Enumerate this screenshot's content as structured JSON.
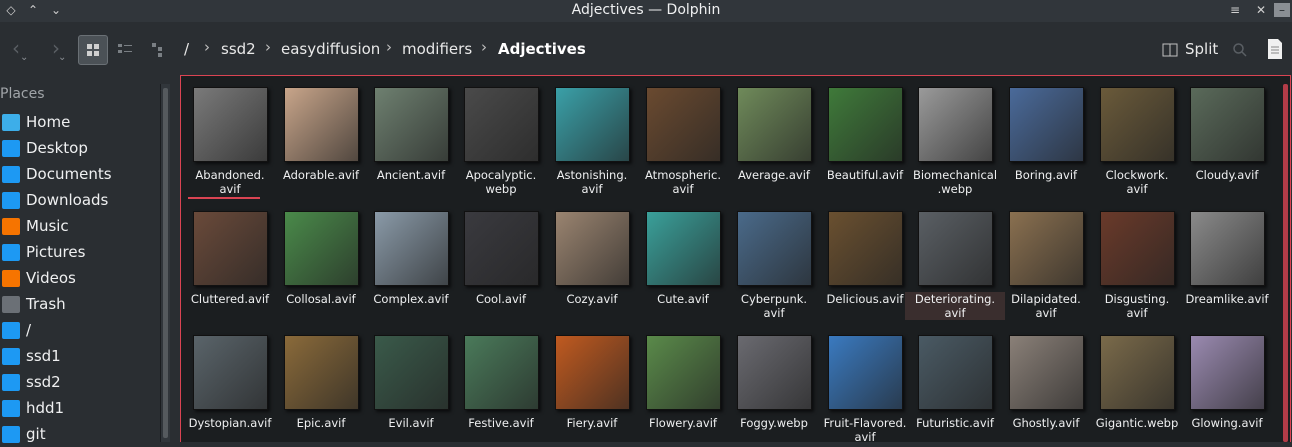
{
  "window": {
    "title": "Adjectives — Dolphin"
  },
  "titlebar": {
    "left_icons": [
      "menu-icon",
      "chevron-up-icon",
      "chevron-down-icon"
    ],
    "right_icons": [
      "hamburger-icon",
      "close-icon",
      "minimize-icon"
    ]
  },
  "toolbar": {
    "breadcrumb": [
      "/",
      "ssd2",
      "easydiffusion",
      "modifiers",
      "Adjectives"
    ],
    "split_label": "Split"
  },
  "sidebar": {
    "heading": "Places",
    "items": [
      {
        "label": "Home",
        "icon": "home-icon",
        "color": "#3daee9"
      },
      {
        "label": "Desktop",
        "icon": "desktop-icon",
        "color": "#1d99f3"
      },
      {
        "label": "Documents",
        "icon": "documents-icon",
        "color": "#1d99f3"
      },
      {
        "label": "Downloads",
        "icon": "downloads-icon",
        "color": "#1d99f3"
      },
      {
        "label": "Music",
        "icon": "music-icon",
        "color": "#f67400"
      },
      {
        "label": "Pictures",
        "icon": "pictures-icon",
        "color": "#1d99f3"
      },
      {
        "label": "Videos",
        "icon": "videos-icon",
        "color": "#f67400"
      },
      {
        "label": "Trash",
        "icon": "trash-icon",
        "color": "#6b7076"
      },
      {
        "label": "/",
        "icon": "root-icon",
        "color": "#1d99f3"
      },
      {
        "label": "ssd1",
        "icon": "drive-icon",
        "color": "#1d99f3"
      },
      {
        "label": "ssd2",
        "icon": "drive-icon",
        "color": "#1d99f3"
      },
      {
        "label": "hdd1",
        "icon": "drive-icon",
        "color": "#1d99f3"
      },
      {
        "label": "git",
        "icon": "folder-icon",
        "color": "#1d99f3"
      }
    ]
  },
  "files": [
    [
      {
        "l1": "Abandoned.",
        "l2": "avif",
        "c": "#7a7a7a"
      },
      {
        "l1": "Adorable.avif",
        "l2": "",
        "c": "#c8a58a"
      },
      {
        "l1": "Ancient.avif",
        "l2": "",
        "c": "#6e8070"
      },
      {
        "l1": "Apocalyptic.",
        "l2": "webp",
        "c": "#4a4a4a"
      },
      {
        "l1": "Astonishing.",
        "l2": "avif",
        "c": "#3aa0a8"
      },
      {
        "l1": "Atmospheric.",
        "l2": "avif",
        "c": "#6a4a30"
      },
      {
        "l1": "Average.avif",
        "l2": "",
        "c": "#6f8a5a"
      },
      {
        "l1": "Beautiful.avif",
        "l2": "",
        "c": "#3f7a3a"
      },
      {
        "l1": "Biomechanical",
        "l2": ".webp",
        "c": "#9a9a9a"
      },
      {
        "l1": "Boring.avif",
        "l2": "",
        "c": "#4a6a9a"
      },
      {
        "l1": "Clockwork.",
        "l2": "avif",
        "c": "#6a5a3a"
      },
      {
        "l1": "Cloudy.avif",
        "l2": "",
        "c": "#5a6a5a"
      }
    ],
    [
      {
        "l1": "Cluttered.avif",
        "l2": "",
        "c": "#6a4a3a"
      },
      {
        "l1": "Collosal.avif",
        "l2": "",
        "c": "#4a8a4a"
      },
      {
        "l1": "Complex.avif",
        "l2": "",
        "c": "#8a9aa8"
      },
      {
        "l1": "Cool.avif",
        "l2": "",
        "c": "#3a3a3f"
      },
      {
        "l1": "Cozy.avif",
        "l2": "",
        "c": "#9a8470"
      },
      {
        "l1": "Cute.avif",
        "l2": "",
        "c": "#3aa09a"
      },
      {
        "l1": "Cyberpunk.",
        "l2": "avif",
        "c": "#4a6a8a"
      },
      {
        "l1": "Delicious.avif",
        "l2": "",
        "c": "#6a5030"
      },
      {
        "l1": "Deteriorating.",
        "l2": "avif",
        "c": "#5a5f64"
      },
      {
        "l1": "Dilapidated.",
        "l2": "avif",
        "c": "#8a7050"
      },
      {
        "l1": "Disgusting.",
        "l2": "avif",
        "c": "#6a3a2a"
      },
      {
        "l1": "Dreamlike.avif",
        "l2": "",
        "c": "#8a8a8a"
      }
    ],
    [
      {
        "l1": "Dystopian.avif",
        "l2": "",
        "c": "#5a646a"
      },
      {
        "l1": "Epic.avif",
        "l2": "",
        "c": "#8a6a3a"
      },
      {
        "l1": "Evil.avif",
        "l2": "",
        "c": "#3a5a4a"
      },
      {
        "l1": "Festive.avif",
        "l2": "",
        "c": "#4a7a5a"
      },
      {
        "l1": "Fiery.avif",
        "l2": "",
        "c": "#c05a20"
      },
      {
        "l1": "Flowery.avif",
        "l2": "",
        "c": "#5a8a4a"
      },
      {
        "l1": "Foggy.webp",
        "l2": "",
        "c": "#6a6a70"
      },
      {
        "l1": "Fruit-Flavored.",
        "l2": "avif",
        "c": "#3a7ac0"
      },
      {
        "l1": "Futuristic.avif",
        "l2": "",
        "c": "#4a5a64"
      },
      {
        "l1": "Ghostly.avif",
        "l2": "",
        "c": "#8a8078"
      },
      {
        "l1": "Gigantic.webp",
        "l2": "",
        "c": "#7a6a4a"
      },
      {
        "l1": "Glowing.avif",
        "l2": "",
        "c": "#9a8ab0"
      }
    ]
  ]
}
